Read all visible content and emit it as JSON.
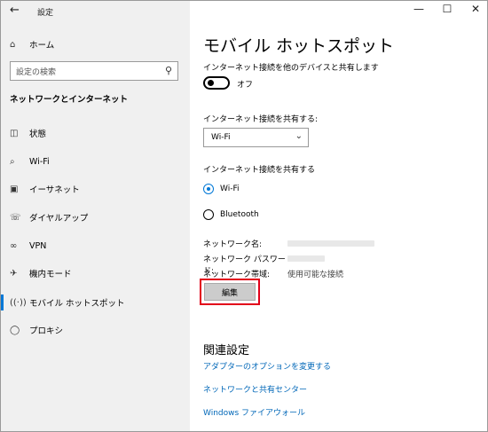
{
  "titlebar": {
    "back_icon": "arrow-left-icon",
    "title": "設定",
    "minimize": "—",
    "maximize": "☐",
    "close": "✕"
  },
  "sidebar": {
    "home_label": "ホーム",
    "search_placeholder": "設定の検索",
    "section_title": "ネットワークとインターネット",
    "items": [
      {
        "label": "状態",
        "icon": "status-icon"
      },
      {
        "label": "Wi-Fi",
        "icon": "wifi-icon"
      },
      {
        "label": "イーサネット",
        "icon": "ethernet-icon"
      },
      {
        "label": "ダイヤルアップ",
        "icon": "dialup-icon"
      },
      {
        "label": "VPN",
        "icon": "vpn-icon"
      },
      {
        "label": "機内モード",
        "icon": "airplane-icon"
      },
      {
        "label": "モバイル ホットスポット",
        "icon": "hotspot-icon",
        "selected": true
      },
      {
        "label": "プロキシ",
        "icon": "globe-icon"
      }
    ],
    "accent_color": "#0078d7"
  },
  "main": {
    "title": "モバイル ホットスポット",
    "share_label": "インターネット接続を他のデバイスと共有します",
    "toggle_state": "オフ",
    "share_from_label": "インターネット接続を共有する:",
    "share_from_value": "Wi-Fi",
    "share_over_label": "インターネット接続を共有する",
    "share_over_options": [
      {
        "label": "Wi-Fi",
        "selected": true
      },
      {
        "label": "Bluetooth",
        "selected": false
      }
    ],
    "network_name_label": "ネットワーク名:",
    "network_password_label": "ネットワーク パスワード:",
    "network_band_label": "ネットワーク帯域:",
    "network_band_value": "使用可能な接続",
    "edit_button": "編集",
    "related_title": "関連設定",
    "links": [
      "アダプターのオプションを変更する",
      "ネットワークと共有センター",
      "Windows ファイアウォール"
    ],
    "link_color": "#0067b8",
    "highlight_color": "#e2001a"
  }
}
